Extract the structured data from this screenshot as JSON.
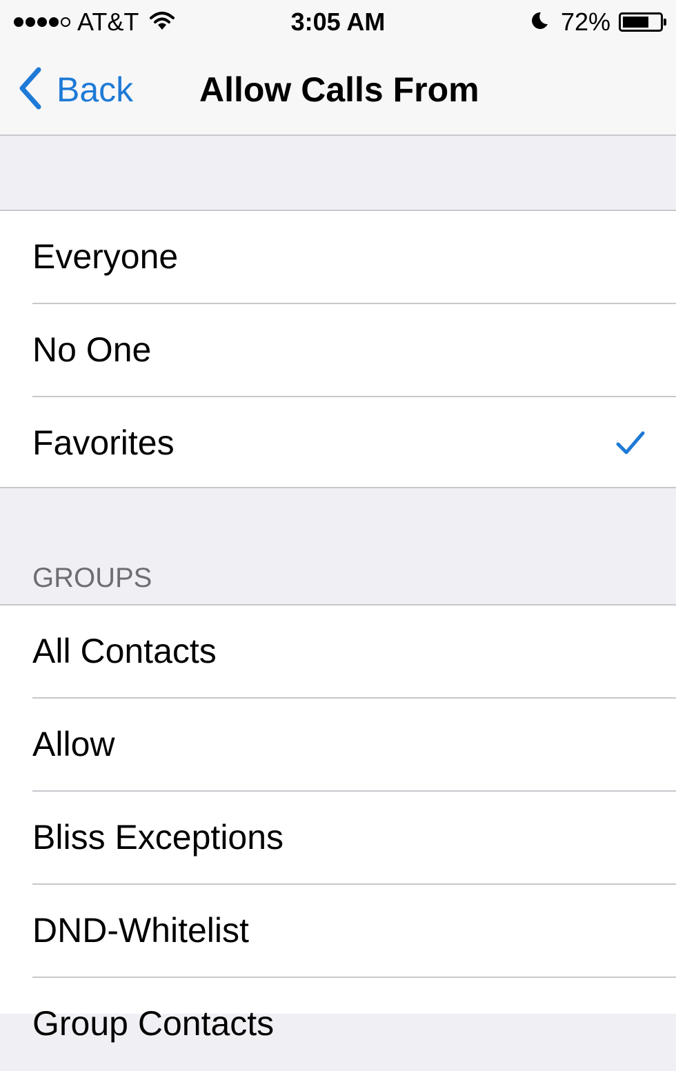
{
  "status_bar": {
    "signal_bars": 5,
    "signal_filled": 4,
    "carrier": "AT&T",
    "time": "3:05 AM",
    "battery_percent": "72%",
    "battery_level": 0.72,
    "icons": {
      "wifi": "wifi-icon",
      "do_not_disturb": "moon-icon",
      "battery": "battery-icon"
    }
  },
  "nav": {
    "back_label": "Back",
    "title": "Allow Calls From",
    "accent_color": "#1e7ad6"
  },
  "options": [
    {
      "label": "Everyone",
      "selected": false
    },
    {
      "label": "No One",
      "selected": false
    },
    {
      "label": "Favorites",
      "selected": true
    }
  ],
  "groups_header": "GROUPS",
  "groups": [
    {
      "label": "All Contacts"
    },
    {
      "label": "Allow"
    },
    {
      "label": "Bliss Exceptions"
    },
    {
      "label": "DND-Whitelist"
    },
    {
      "label": "Group Contacts"
    }
  ],
  "colors": {
    "background": "#efeff4",
    "separator": "#c8c7cc",
    "checkmark": "#1e7ad6",
    "header_text": "#6d6d72"
  }
}
